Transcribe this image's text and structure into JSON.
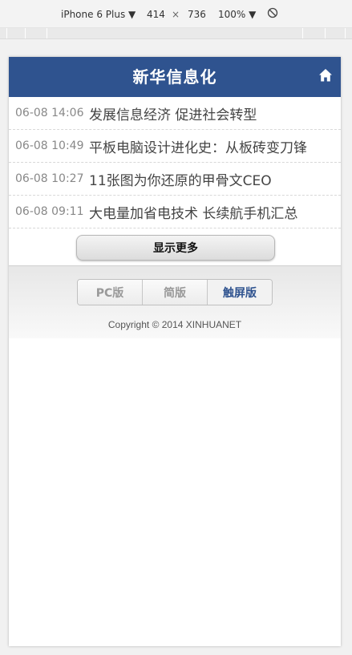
{
  "devtools": {
    "device": "iPhone 6 Plus ▼",
    "width": "414",
    "times": "×",
    "height": "736",
    "zoom": "100% ▼"
  },
  "app": {
    "title": "新华信息化",
    "home_icon": "home-icon"
  },
  "news": [
    {
      "time": "06-08 14:06",
      "title": "发展信息经济 促进社会转型"
    },
    {
      "time": "06-08 10:49",
      "title": "平板电脑设计进化史：从板砖变刀锋"
    },
    {
      "time": "06-08 10:27",
      "title": "11张图为你还原的甲骨文CEO"
    },
    {
      "time": "06-08 09:11",
      "title": "大电量加省电技术 长续航手机汇总"
    }
  ],
  "more_label": "显示更多",
  "versions": [
    {
      "label": "PC版"
    },
    {
      "label": "简版"
    },
    {
      "label": "触屏版",
      "active": true
    }
  ],
  "copyright": "Copyright © 2014 XINHUANET",
  "colors": {
    "header_bg": "#2f538f",
    "active_tab": "#2f538f"
  }
}
